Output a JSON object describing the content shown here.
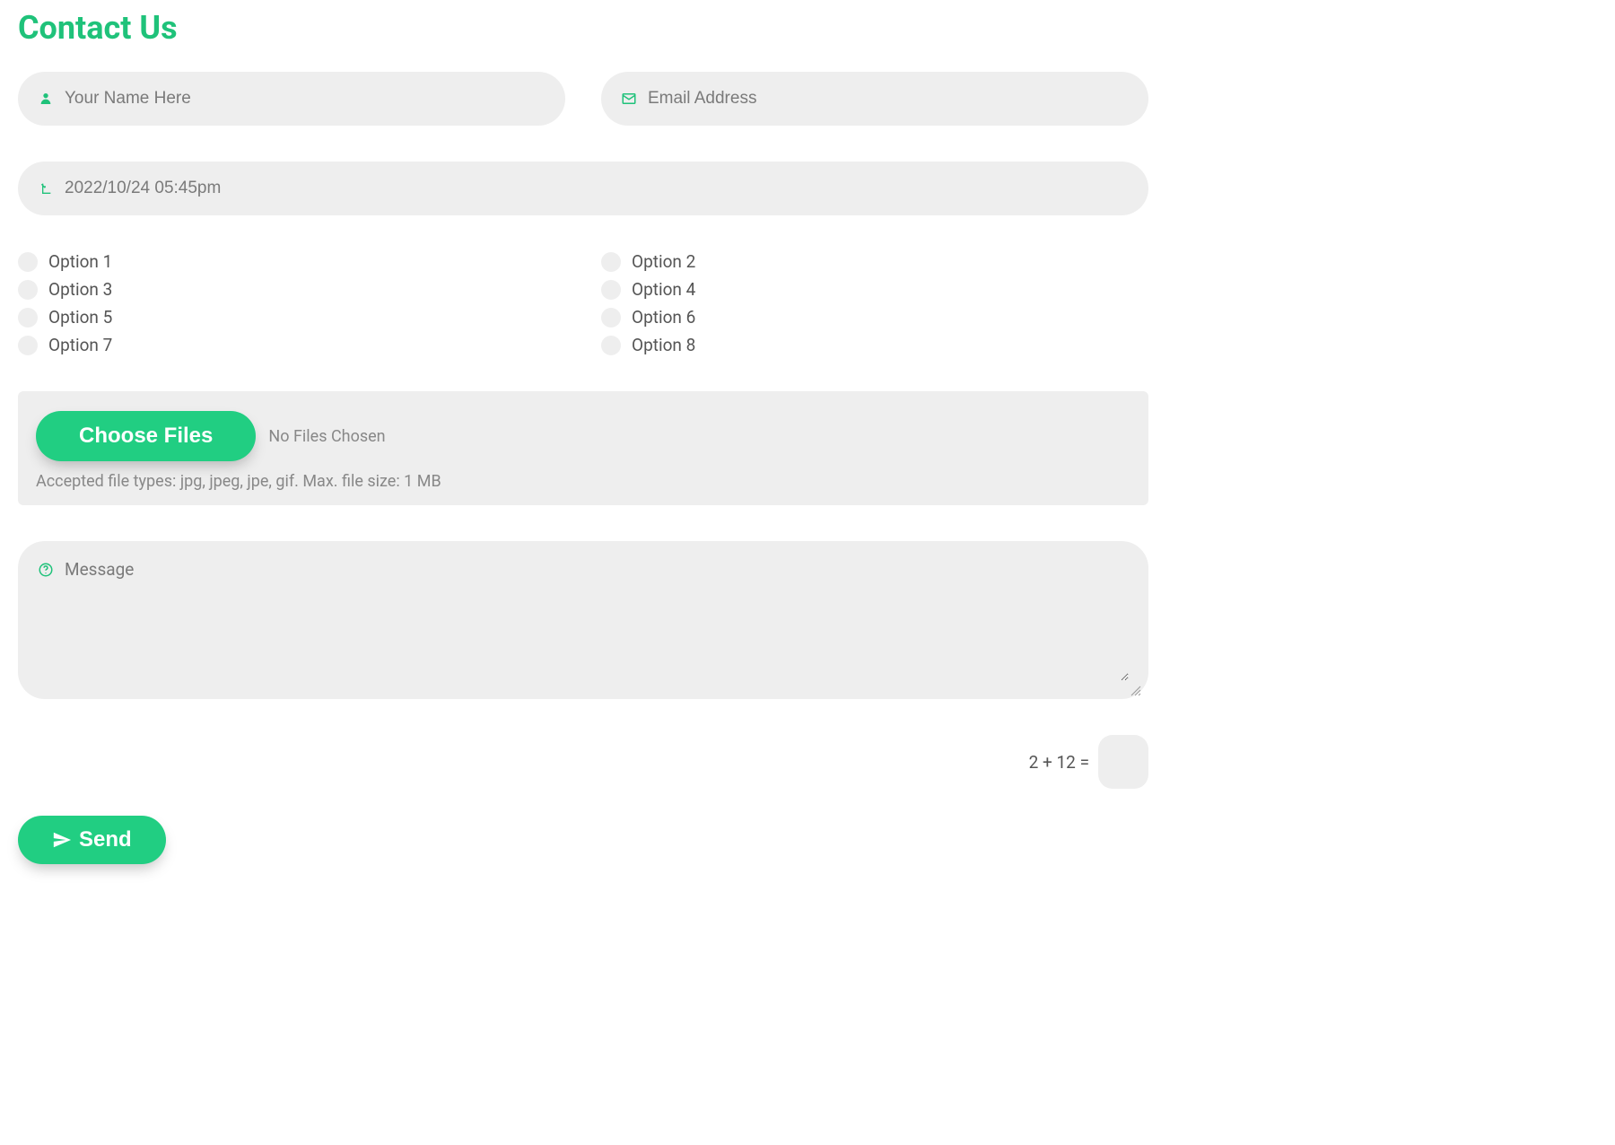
{
  "title": "Contact Us",
  "name": {
    "placeholder": "Your Name Here",
    "value": ""
  },
  "email": {
    "placeholder": "Email Address",
    "value": ""
  },
  "datetime": {
    "placeholder": "2022/10/24 05:45pm",
    "value": ""
  },
  "checkboxes": [
    {
      "label": "Option 1"
    },
    {
      "label": "Option 2"
    },
    {
      "label": "Option 3"
    },
    {
      "label": "Option 4"
    },
    {
      "label": "Option 5"
    },
    {
      "label": "Option 6"
    },
    {
      "label": "Option 7"
    },
    {
      "label": "Option 8"
    }
  ],
  "file": {
    "button_label": "Choose Files",
    "status": "No Files Chosen",
    "hint": "Accepted file types: jpg, jpeg, jpe, gif. Max. file size: 1 MB"
  },
  "message": {
    "placeholder": "Message",
    "value": ""
  },
  "captcha": {
    "question": "2 + 12 =",
    "value": ""
  },
  "submit": {
    "label": "Send"
  },
  "colors": {
    "accent": "#1fc27a",
    "field_bg": "#eeeeee"
  }
}
